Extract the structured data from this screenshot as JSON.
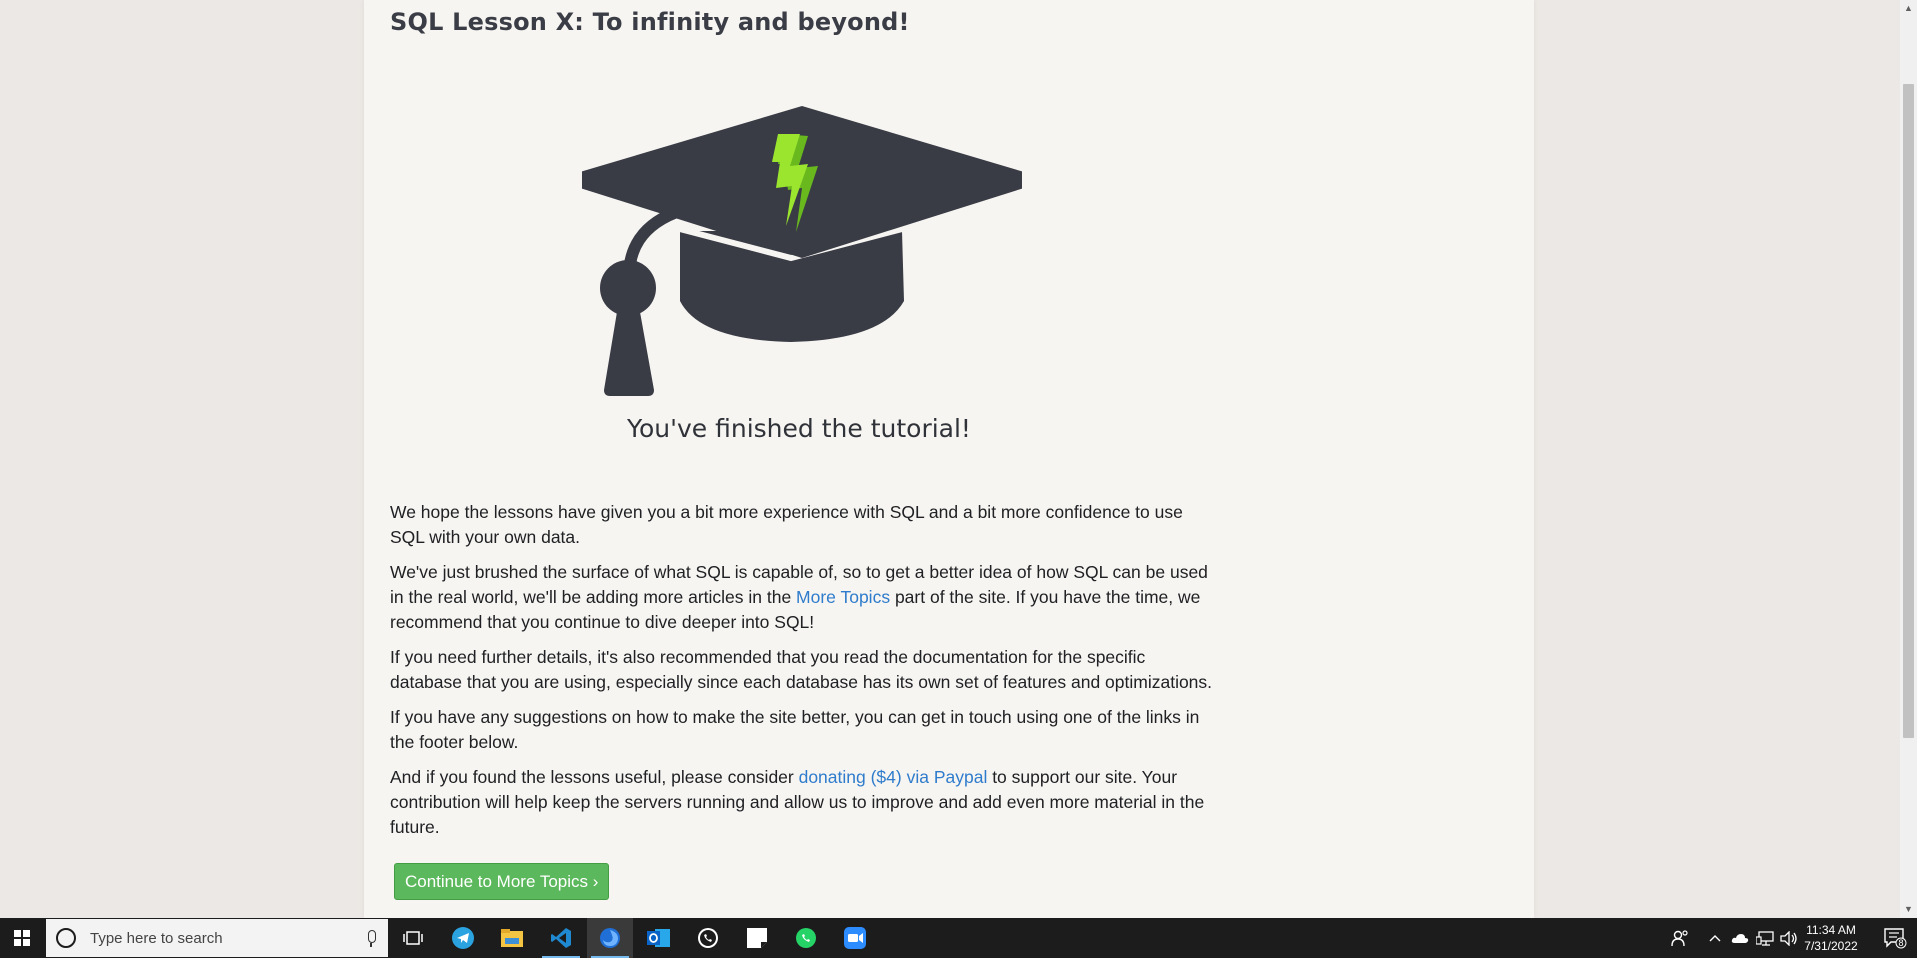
{
  "lesson": {
    "title": "SQL Lesson X: To infinity and beyond!",
    "caption": "You've finished the tutorial!",
    "p1": "We hope the lessons have given you a bit more experience with SQL and a bit more confidence to use SQL with your own data.",
    "p2_before": "We've just brushed the surface of what SQL is capable of, so to get a better idea of how SQL can be used in the real world, we'll be adding more articles in the ",
    "p2_link": "More Topics",
    "p2_after": " part of the site. If you have the time, we recommend that you continue to dive deeper into SQL!",
    "p3": "If you need further details, it's also recommended that you read the documentation for the specific database that you are using, especially since each database has its own set of features and optimizations.",
    "p4": "If you have any suggestions on how to make the site better, you can get in touch using one of the links in the footer below.",
    "p5_before": "And if you found the lessons useful, please consider ",
    "p5_link": "donating ($4) via Paypal",
    "p5_after": " to support our site. Your contribution will help keep the servers running and allow us to improve and add even more material in the future.",
    "continue_button": "Continue to More Topics ›"
  },
  "colors": {
    "cap": "#393c45",
    "bolt_light": "#9be52e",
    "bolt_dark": "#69b81e",
    "link": "#2f7ccc",
    "button": "#5cb85c"
  },
  "taskbar": {
    "search_placeholder": "Type here to search",
    "apps": [
      {
        "name": "task-view-icon"
      },
      {
        "name": "telegram-icon"
      },
      {
        "name": "file-explorer-icon"
      },
      {
        "name": "vscode-icon"
      },
      {
        "name": "firefox-icon"
      },
      {
        "name": "outlook-icon"
      },
      {
        "name": "whatsapp-icon"
      },
      {
        "name": "sticky-notes-icon"
      },
      {
        "name": "whatsapp-business-icon"
      },
      {
        "name": "zoom-icon"
      }
    ],
    "clock_time": "11:34 AM",
    "clock_date": "7/31/2022",
    "notification_count": "8"
  }
}
